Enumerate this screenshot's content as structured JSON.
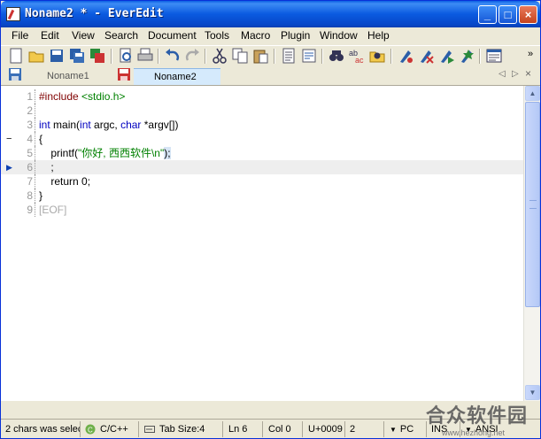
{
  "window": {
    "title": "Noname2 * - EverEdit",
    "controls": {
      "minimize": "_",
      "maximize": "□",
      "close": "×"
    }
  },
  "menu": [
    "File",
    "Edit",
    "View",
    "Search",
    "Document",
    "Tools",
    "Macro",
    "Plugin",
    "Window",
    "Help"
  ],
  "toolbar": {
    "icons": [
      "new-file-icon",
      "open-folder-icon",
      "save-icon",
      "save-all-icon",
      "copy-window-icon",
      "print-preview-icon",
      "print-icon",
      "undo-icon",
      "redo-icon",
      "cut-icon",
      "copy-icon",
      "paste-icon",
      "document-icon",
      "options-icon",
      "find-icon",
      "replace-icon",
      "find-in-files-icon",
      "macro-record-icon",
      "macro-stop-icon",
      "macro-play-icon",
      "macro-run-icon",
      "window-icon"
    ],
    "more": "»"
  },
  "tabs": [
    {
      "label": "Noname1",
      "active": false
    },
    {
      "label": "Noname2",
      "active": true
    }
  ],
  "tab_nav": {
    "prev": "◁",
    "next": "▷",
    "close": "×"
  },
  "editor": {
    "current_line": 6,
    "lines": [
      {
        "num": "1",
        "parts": [
          [
            "kw-pre",
            "#include "
          ],
          [
            "kw-inc",
            "<stdio.h>"
          ]
        ]
      },
      {
        "num": "2",
        "parts": []
      },
      {
        "num": "3",
        "parts": [
          [
            "kw-type",
            "int"
          ],
          [
            "",
            " main("
          ],
          [
            "kw-type",
            "int"
          ],
          [
            "",
            " argc, "
          ],
          [
            "kw-type",
            "char"
          ],
          [
            "",
            " *argv[])"
          ]
        ]
      },
      {
        "num": "4",
        "parts": [
          [
            "",
            "{"
          ]
        ],
        "marker": "−"
      },
      {
        "num": "5",
        "parts": [
          [
            "",
            "    printf("
          ],
          [
            "str",
            "\"你好, 西西软件\\n\""
          ],
          [
            "",
            ");"
          ]
        ]
      },
      {
        "num": "6",
        "parts": [
          [
            "",
            "    ;"
          ]
        ],
        "marker": "▶"
      },
      {
        "num": "7",
        "parts": [
          [
            "",
            "    return 0;"
          ]
        ]
      },
      {
        "num": "8",
        "parts": [
          [
            "",
            "}"
          ]
        ]
      },
      {
        "num": "9",
        "parts": [
          [
            "eof",
            "[EOF]"
          ]
        ]
      }
    ]
  },
  "status": {
    "selection": "2 chars was selec",
    "language": "C/C++",
    "tab_size": "Tab Size:4",
    "line": "Ln 6",
    "col": "Col 0",
    "unicode": "U+0009",
    "count": "2",
    "eol": "PC",
    "mode": "INS",
    "encoding": "ANSI"
  },
  "watermark": {
    "text": "合众软件园",
    "url": "www.hezhong.net"
  },
  "colors": {
    "title_bar": "#0a5ae0",
    "current_line": "#eeeeee",
    "keyword": "#0000c0",
    "string": "#008000",
    "preprocessor": "#800000"
  }
}
